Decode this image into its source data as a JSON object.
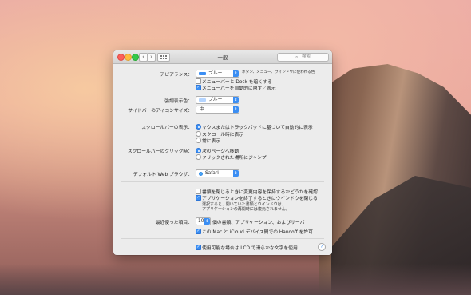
{
  "window": {
    "title": "一般",
    "search_placeholder": "検索",
    "nav_back": "‹",
    "nav_forward": "›"
  },
  "appearance": {
    "label": "アピアランス：",
    "value": "ブルー",
    "note": "ボタン、メニュー、ウインドウに使われる色",
    "swatch_color": "#3b8ef3",
    "dark_menu_label": "メニューバーと Dock を暗くする",
    "autohide_menu_label": "メニューバーを自動的に隠す／表示"
  },
  "highlight": {
    "label": "強調表示色：",
    "value": "ブルー",
    "swatch_color": "#b5d5ff"
  },
  "sidebar_icon": {
    "label": "サイドバーのアイコンサイズ：",
    "value": "中"
  },
  "scrollbars": {
    "label": "スクロールバーの表示：",
    "options": [
      "マウスまたはトラックパッドに基づいて自動的に表示",
      "スクロール時に表示",
      "常に表示"
    ]
  },
  "scroll_click": {
    "label": "スクロールバーのクリック時：",
    "options": [
      "次のページへ移動",
      "クリックされた場所にジャンプ"
    ]
  },
  "browser": {
    "label": "デフォルト Web ブラウザ：",
    "value": "Safari"
  },
  "documents": {
    "ask_keep_changes": "書類を閉じるときに変更内容を保持するかどうかを確認",
    "close_windows": "アプリケーションを終了するときにウインドウを閉じる",
    "note_line1": "選択すると、開いていた書類とウインドウは、",
    "note_line2": "アプリケーションの再開時には復元されません。"
  },
  "recent": {
    "label": "最近使った項目：",
    "value": "10",
    "suffix": "個の書類、アプリケーション、およびサーバ"
  },
  "handoff": {
    "label": "この Mac と iCloud デバイス間での Handoff を許可"
  },
  "lcd": {
    "label": "使用可能な場合は LCD で滑らかな文字を使用"
  },
  "help_label": "?"
}
